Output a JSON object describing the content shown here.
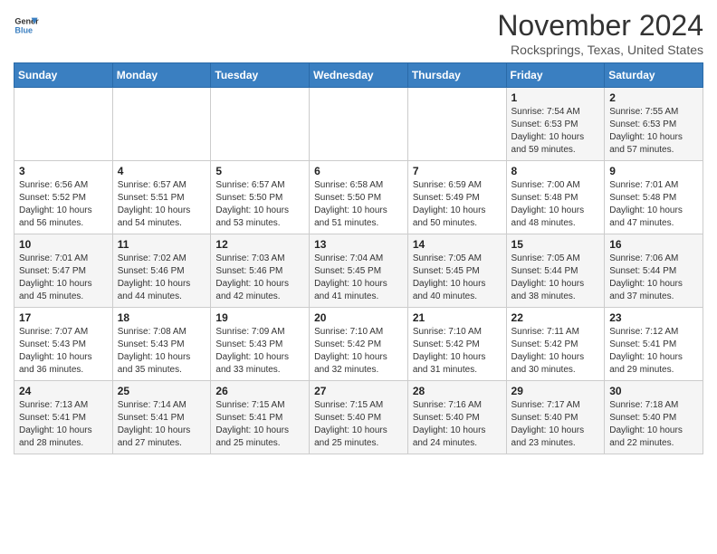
{
  "logo": {
    "line1": "General",
    "line2": "Blue"
  },
  "title": "November 2024",
  "location": "Rocksprings, Texas, United States",
  "weekdays": [
    "Sunday",
    "Monday",
    "Tuesday",
    "Wednesday",
    "Thursday",
    "Friday",
    "Saturday"
  ],
  "weeks": [
    [
      {
        "day": "",
        "info": ""
      },
      {
        "day": "",
        "info": ""
      },
      {
        "day": "",
        "info": ""
      },
      {
        "day": "",
        "info": ""
      },
      {
        "day": "",
        "info": ""
      },
      {
        "day": "1",
        "info": "Sunrise: 7:54 AM\nSunset: 6:53 PM\nDaylight: 10 hours\nand 59 minutes."
      },
      {
        "day": "2",
        "info": "Sunrise: 7:55 AM\nSunset: 6:53 PM\nDaylight: 10 hours\nand 57 minutes."
      }
    ],
    [
      {
        "day": "3",
        "info": "Sunrise: 6:56 AM\nSunset: 5:52 PM\nDaylight: 10 hours\nand 56 minutes."
      },
      {
        "day": "4",
        "info": "Sunrise: 6:57 AM\nSunset: 5:51 PM\nDaylight: 10 hours\nand 54 minutes."
      },
      {
        "day": "5",
        "info": "Sunrise: 6:57 AM\nSunset: 5:50 PM\nDaylight: 10 hours\nand 53 minutes."
      },
      {
        "day": "6",
        "info": "Sunrise: 6:58 AM\nSunset: 5:50 PM\nDaylight: 10 hours\nand 51 minutes."
      },
      {
        "day": "7",
        "info": "Sunrise: 6:59 AM\nSunset: 5:49 PM\nDaylight: 10 hours\nand 50 minutes."
      },
      {
        "day": "8",
        "info": "Sunrise: 7:00 AM\nSunset: 5:48 PM\nDaylight: 10 hours\nand 48 minutes."
      },
      {
        "day": "9",
        "info": "Sunrise: 7:01 AM\nSunset: 5:48 PM\nDaylight: 10 hours\nand 47 minutes."
      }
    ],
    [
      {
        "day": "10",
        "info": "Sunrise: 7:01 AM\nSunset: 5:47 PM\nDaylight: 10 hours\nand 45 minutes."
      },
      {
        "day": "11",
        "info": "Sunrise: 7:02 AM\nSunset: 5:46 PM\nDaylight: 10 hours\nand 44 minutes."
      },
      {
        "day": "12",
        "info": "Sunrise: 7:03 AM\nSunset: 5:46 PM\nDaylight: 10 hours\nand 42 minutes."
      },
      {
        "day": "13",
        "info": "Sunrise: 7:04 AM\nSunset: 5:45 PM\nDaylight: 10 hours\nand 41 minutes."
      },
      {
        "day": "14",
        "info": "Sunrise: 7:05 AM\nSunset: 5:45 PM\nDaylight: 10 hours\nand 40 minutes."
      },
      {
        "day": "15",
        "info": "Sunrise: 7:05 AM\nSunset: 5:44 PM\nDaylight: 10 hours\nand 38 minutes."
      },
      {
        "day": "16",
        "info": "Sunrise: 7:06 AM\nSunset: 5:44 PM\nDaylight: 10 hours\nand 37 minutes."
      }
    ],
    [
      {
        "day": "17",
        "info": "Sunrise: 7:07 AM\nSunset: 5:43 PM\nDaylight: 10 hours\nand 36 minutes."
      },
      {
        "day": "18",
        "info": "Sunrise: 7:08 AM\nSunset: 5:43 PM\nDaylight: 10 hours\nand 35 minutes."
      },
      {
        "day": "19",
        "info": "Sunrise: 7:09 AM\nSunset: 5:43 PM\nDaylight: 10 hours\nand 33 minutes."
      },
      {
        "day": "20",
        "info": "Sunrise: 7:10 AM\nSunset: 5:42 PM\nDaylight: 10 hours\nand 32 minutes."
      },
      {
        "day": "21",
        "info": "Sunrise: 7:10 AM\nSunset: 5:42 PM\nDaylight: 10 hours\nand 31 minutes."
      },
      {
        "day": "22",
        "info": "Sunrise: 7:11 AM\nSunset: 5:42 PM\nDaylight: 10 hours\nand 30 minutes."
      },
      {
        "day": "23",
        "info": "Sunrise: 7:12 AM\nSunset: 5:41 PM\nDaylight: 10 hours\nand 29 minutes."
      }
    ],
    [
      {
        "day": "24",
        "info": "Sunrise: 7:13 AM\nSunset: 5:41 PM\nDaylight: 10 hours\nand 28 minutes."
      },
      {
        "day": "25",
        "info": "Sunrise: 7:14 AM\nSunset: 5:41 PM\nDaylight: 10 hours\nand 27 minutes."
      },
      {
        "day": "26",
        "info": "Sunrise: 7:15 AM\nSunset: 5:41 PM\nDaylight: 10 hours\nand 25 minutes."
      },
      {
        "day": "27",
        "info": "Sunrise: 7:15 AM\nSunset: 5:40 PM\nDaylight: 10 hours\nand 25 minutes."
      },
      {
        "day": "28",
        "info": "Sunrise: 7:16 AM\nSunset: 5:40 PM\nDaylight: 10 hours\nand 24 minutes."
      },
      {
        "day": "29",
        "info": "Sunrise: 7:17 AM\nSunset: 5:40 PM\nDaylight: 10 hours\nand 23 minutes."
      },
      {
        "day": "30",
        "info": "Sunrise: 7:18 AM\nSunset: 5:40 PM\nDaylight: 10 hours\nand 22 minutes."
      }
    ]
  ]
}
